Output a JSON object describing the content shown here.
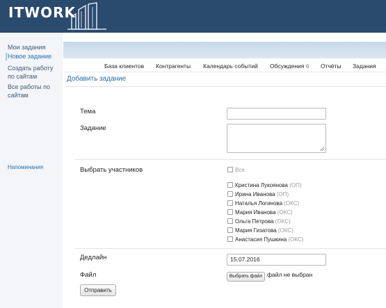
{
  "app": {
    "logo_text": "ITWORK"
  },
  "sidebar": {
    "items": [
      {
        "label": "Мои задания"
      },
      {
        "label": "Новое задание"
      },
      {
        "label": "Создать работу"
      },
      {
        "label": "по сайтам"
      },
      {
        "label": "Все работы по"
      },
      {
        "label": "сайтам"
      }
    ],
    "reminders": "Напоминания"
  },
  "menu": {
    "items": [
      {
        "label": "База клиентов"
      },
      {
        "label": "Контрагенты"
      },
      {
        "label": "Календарь событий"
      },
      {
        "label": "Обсуждения",
        "count": "6"
      },
      {
        "label": "Отчёты"
      },
      {
        "label": "Задания"
      }
    ]
  },
  "page": {
    "title": "Добавить задание"
  },
  "form": {
    "topic_label": "Тема",
    "topic_value": "",
    "task_label": "Задание",
    "task_value": "",
    "participants_label": "Выбрать участников",
    "select_all": "Все",
    "participants": [
      {
        "name": "Кристина Лукоянова",
        "dept": "(ОП)"
      },
      {
        "name": "Ирина Иванова",
        "dept": "(ОП)"
      },
      {
        "name": "Наталья Логинова",
        "dept": "(ОКС)"
      },
      {
        "name": "Мария Иванова",
        "dept": "(ОКС)"
      },
      {
        "name": "Ольга Петрова",
        "dept": "(ОКС)"
      },
      {
        "name": "Мария Гизатова",
        "dept": "(ОКС)"
      },
      {
        "name": "Анастасия Пушкина",
        "dept": "(ОКС)"
      }
    ],
    "deadline_label": "Дедлайн",
    "deadline_value": "15.07.2016",
    "file_label": "Файл",
    "file_button": "Выбрать файл",
    "file_status": "файл не выбран",
    "submit": "Отправить"
  }
}
